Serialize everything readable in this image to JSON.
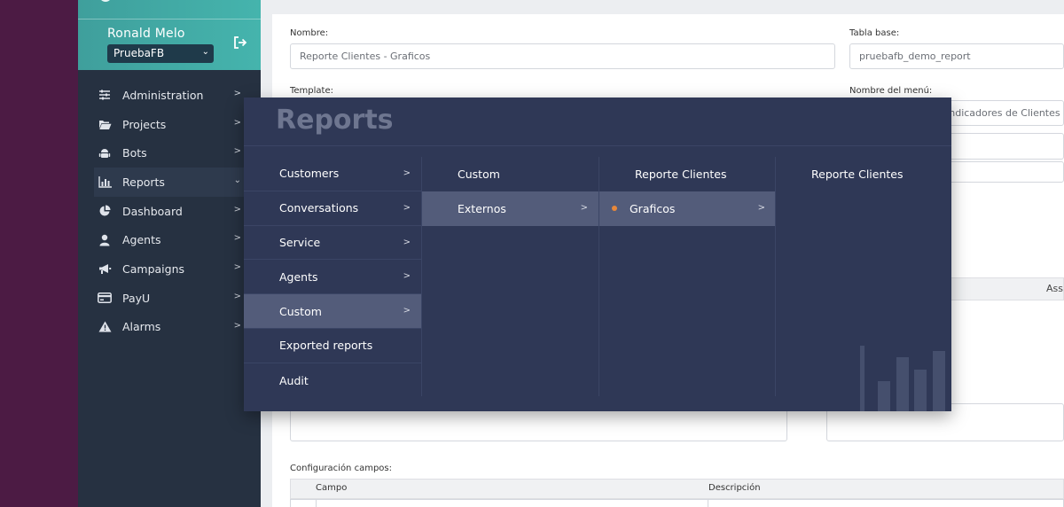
{
  "sidebar": {
    "user_name": "Ronald Melo",
    "account": "PruebaFB",
    "items": [
      {
        "label": "Administration",
        "icon": "sliders-icon"
      },
      {
        "label": "Projects",
        "icon": "folder-open-icon"
      },
      {
        "label": "Bots",
        "icon": "android-icon"
      },
      {
        "label": "Reports",
        "icon": "bar-chart-icon",
        "active": true
      },
      {
        "label": "Dashboard",
        "icon": "pie-chart-icon"
      },
      {
        "label": "Agents",
        "icon": "user-icon"
      },
      {
        "label": "Campaigns",
        "icon": "megaphone-icon"
      },
      {
        "label": "PayU",
        "icon": "credit-card-icon"
      },
      {
        "label": "Alarms",
        "icon": "warning-icon"
      }
    ]
  },
  "form": {
    "nombre_label": "Nombre:",
    "nombre_value": "Reporte Clientes - Graficos",
    "tabla_label": "Tabla base:",
    "tabla_value": "pruebafb_demo_report",
    "template_label": "Template:",
    "menu_label": "Nombre del menú:",
    "menu_value": "Indicadores de Clientes",
    "ass_text": "Ass",
    "config_label": "Configuración campos:",
    "col_campo": "Campo",
    "col_descripcion": "Descripción"
  },
  "mega_menu": {
    "title": "Reports",
    "col1": [
      "Customers",
      "Conversations",
      "Service",
      "Agents",
      "Custom",
      "Exported reports",
      "Audit"
    ],
    "col1_selected": "Custom",
    "col2_header": "Custom",
    "col2_item": "Externos",
    "col3_header": "Reporte Clientes",
    "col3_item": "Graficos",
    "col4_header": "Reporte Clientes"
  },
  "colors": {
    "sidebar_bg": "#263141",
    "profile_bg": "#45b4ad",
    "menu_bg": "#2f3856",
    "menu_selected": "#535c7a",
    "bullet": "#e8883a",
    "left_strip": "#4c1b44"
  }
}
